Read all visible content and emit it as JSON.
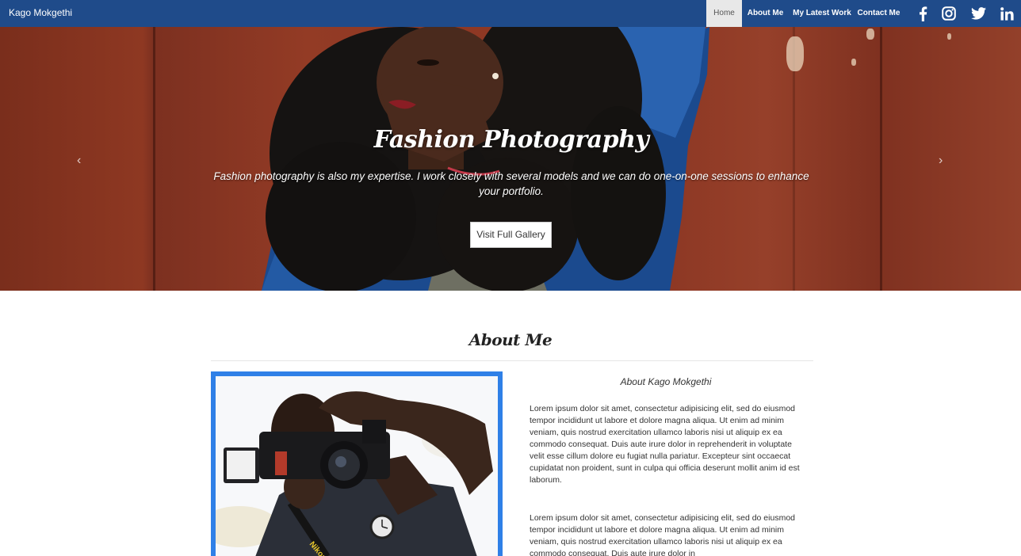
{
  "nav": {
    "brand": "Kago Mokgethi",
    "links": [
      {
        "label": "Home",
        "active": true
      },
      {
        "label": "About Me",
        "active": false
      },
      {
        "label": "My Latest Work",
        "active": false
      },
      {
        "label": "Contact Me",
        "active": false
      }
    ],
    "social": [
      "facebook-icon",
      "instagram-icon",
      "twitter-icon",
      "linkedin-icon"
    ],
    "bar_color": "#1f4b8a"
  },
  "hero": {
    "title": "Fashion Photography",
    "text": "Fashion photography is also my expertise. I work closely with several models and we can do one-on-one sessions to enhance your portfolio.",
    "button": "Visit Full Gallery",
    "prev": "‹",
    "next": "›"
  },
  "about": {
    "title": "About Me",
    "subtitle": "About Kago Mokgethi",
    "paragraphs": [
      "Lorem ipsum dolor sit amet, consectetur adipisicing elit, sed do eiusmod tempor incididunt ut labore et dolore magna aliqua. Ut enim ad minim veniam, quis nostrud exercitation ullamco laboris nisi ut aliquip ex ea commodo consequat. Duis aute irure dolor in reprehenderit in voluptate velit esse cillum dolore eu fugiat nulla pariatur. Excepteur sint occaecat cupidatat non proident, sunt in culpa qui officia deserunt mollit anim id est laborum.",
      "Lorem ipsum dolor sit amet, consectetur adipisicing elit, sed do eiusmod tempor incididunt ut labore et dolore magna aliqua. Ut enim ad minim veniam, quis nostrud exercitation ullamco laboris nisi ut aliquip ex ea commodo consequat. Duis aute irure dolor in"
    ],
    "frame_color": "#2f80e7",
    "camera_brand": "Nikon"
  }
}
